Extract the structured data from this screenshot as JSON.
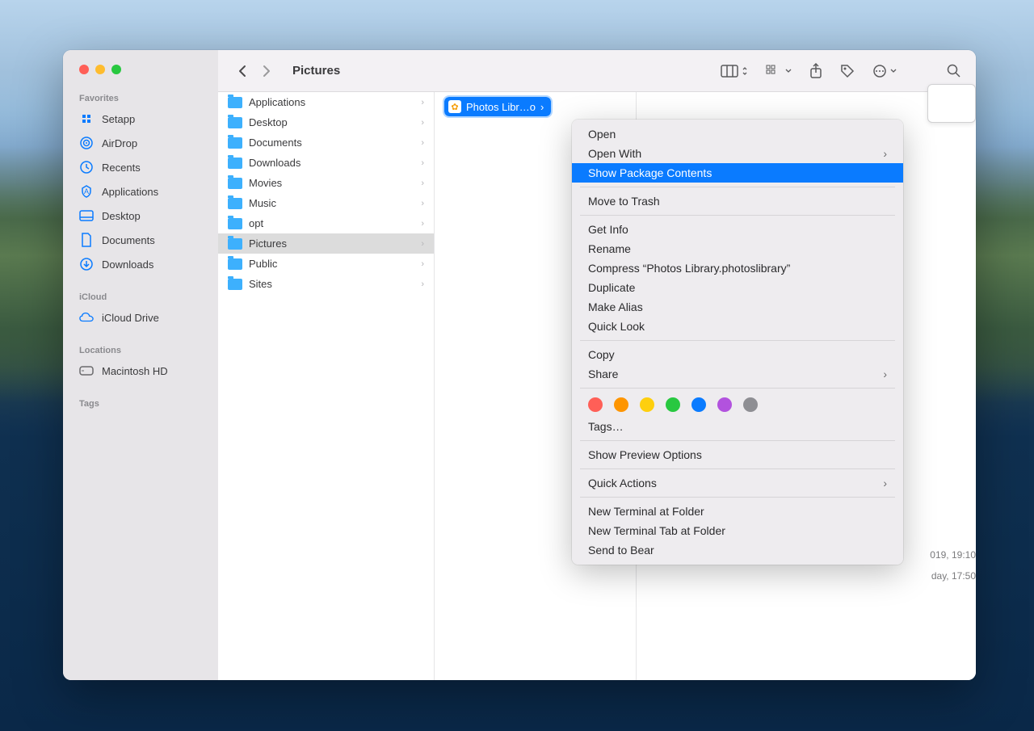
{
  "window_title": "Pictures",
  "sidebar": {
    "sections": [
      {
        "heading": "Favorites",
        "items": [
          {
            "label": "Setapp",
            "icon": "setapp"
          },
          {
            "label": "AirDrop",
            "icon": "airdrop"
          },
          {
            "label": "Recents",
            "icon": "recents"
          },
          {
            "label": "Applications",
            "icon": "applications"
          },
          {
            "label": "Desktop",
            "icon": "desktop"
          },
          {
            "label": "Documents",
            "icon": "documents"
          },
          {
            "label": "Downloads",
            "icon": "downloads"
          }
        ]
      },
      {
        "heading": "iCloud",
        "items": [
          {
            "label": "iCloud Drive",
            "icon": "icloud"
          }
        ]
      },
      {
        "heading": "Locations",
        "items": [
          {
            "label": "Macintosh HD",
            "icon": "hd"
          }
        ]
      },
      {
        "heading": "Tags",
        "items": []
      }
    ]
  },
  "column1": [
    {
      "name": "Applications",
      "has_children": true
    },
    {
      "name": "Desktop",
      "has_children": true
    },
    {
      "name": "Documents",
      "has_children": true
    },
    {
      "name": "Downloads",
      "has_children": true
    },
    {
      "name": "Movies",
      "has_children": true
    },
    {
      "name": "Music",
      "has_children": true
    },
    {
      "name": "opt",
      "has_children": true
    },
    {
      "name": "Pictures",
      "has_children": true,
      "selected": true
    },
    {
      "name": "Public",
      "has_children": true
    },
    {
      "name": "Sites",
      "has_children": true
    }
  ],
  "column2": {
    "selected_file": "Photos Libr…o"
  },
  "context_menu": {
    "items": [
      {
        "label": "Open"
      },
      {
        "label": "Open With",
        "submenu": true
      },
      {
        "label": "Show Package Contents",
        "highlighted": true
      },
      {
        "sep": true
      },
      {
        "label": "Move to Trash"
      },
      {
        "sep": true
      },
      {
        "label": "Get Info"
      },
      {
        "label": "Rename"
      },
      {
        "label": "Compress “Photos Library.photoslibrary”"
      },
      {
        "label": "Duplicate"
      },
      {
        "label": "Make Alias"
      },
      {
        "label": "Quick Look"
      },
      {
        "sep": true
      },
      {
        "label": "Copy"
      },
      {
        "label": "Share",
        "submenu": true
      },
      {
        "sep": true
      },
      {
        "tags": [
          "#ff5f57",
          "#fe9500",
          "#fecf0e",
          "#28c840",
          "#0a7bff",
          "#b252de",
          "#8e8e93"
        ]
      },
      {
        "label": "Tags…"
      },
      {
        "sep": true
      },
      {
        "label": "Show Preview Options"
      },
      {
        "sep": true
      },
      {
        "label": "Quick Actions",
        "submenu": true
      },
      {
        "sep": true
      },
      {
        "label": "New Terminal at Folder"
      },
      {
        "label": "New Terminal Tab at Folder"
      },
      {
        "label": "Send to Bear"
      }
    ]
  },
  "preview_info": {
    "line1": "019, 19:10",
    "line2": "day, 17:50"
  }
}
